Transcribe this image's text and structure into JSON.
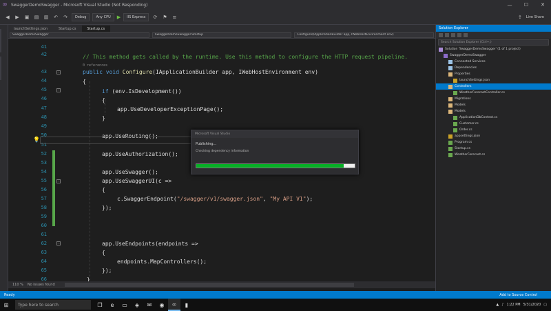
{
  "window": {
    "title": "SwaggerDemoSwagger - Microsoft Visual Studio (Not Responding)",
    "minimize": "—",
    "maximize": "☐",
    "close": "✕"
  },
  "toolbar": {
    "config": "Debug",
    "platform": "Any CPU",
    "run_target": "IIS Express",
    "live_share": "Live Share"
  },
  "doc_tabs": [
    "launchSettings.json",
    "Startup.cs",
    "Startup.cs"
  ],
  "nav": {
    "project": "SwaggerDemoSwagger",
    "class": "SwaggerDemoSwagger.Startup",
    "member": "Configure(IApplicationBuilder app, IWebHostEnvironment env)"
  },
  "editor": {
    "line_numbers": [
      "41",
      "42",
      "",
      "43",
      "44",
      "45",
      "46",
      "47",
      "48",
      "49",
      "50",
      "51",
      "52",
      "53",
      "54",
      "55",
      "56",
      "57",
      "58",
      "59",
      "60",
      "61",
      "62",
      "63",
      "64",
      "65",
      "66"
    ],
    "code": {
      "c1": "// This method gets called by the runtime. Use this method to configure the HTTP request pipeline.",
      "ref": "0 references",
      "c2_kw": "public void ",
      "c2_mt": "Configure",
      "c2_rest": "(IApplicationBuilder app, IWebHostEnvironment env)",
      "open1": "{",
      "if_kw": "if ",
      "if_rest": "(env.IsDevelopment())",
      "open2": "{",
      "dev": "app.UseDeveloperExceptionPage();",
      "close2": "}",
      "routing": "app.UseRouting();",
      "authz": "app.UseAuthorization();",
      "swag": "app.UseSwagger();",
      "swagui": "app.UseSwaggerUI(c =>",
      "open3": "{",
      "endpoint_pre": "c.SwaggerEndpoint(",
      "endpoint_s1": "\"/swagger/v1/swagger.json\"",
      "endpoint_mid": ", ",
      "endpoint_s2": "\"My API V1\"",
      "endpoint_post": ");",
      "close3": "});",
      "endpoints": "app.UseEndpoints(endpoints =>",
      "open4": "{",
      "map": "endpoints.MapControllers();",
      "close4": "});",
      "close1": "}"
    },
    "lightbulb": "💡"
  },
  "dialog": {
    "title": "Microsoft Visual Studio",
    "line1": "Publishing...",
    "line2": "Checking dependency information",
    "progress": 0.93
  },
  "footer": {
    "zoom": "110 %",
    "issues": "No issues found"
  },
  "solution_explorer": {
    "title": "Solution Explorer",
    "search": "Search Solution Explorer (Ctrl+;)",
    "items": [
      {
        "label": "Solution 'SwaggerDemoSwagger' (1 of 1 project)",
        "icon": "sol",
        "indent": 0,
        "selected": false
      },
      {
        "label": "SwaggerDemoSwagger",
        "icon": "proj",
        "indent": 1,
        "selected": false
      },
      {
        "label": "Connected Services",
        "icon": "dep",
        "indent": 2,
        "selected": false
      },
      {
        "label": "Dependencies",
        "icon": "dep",
        "indent": 2,
        "selected": false
      },
      {
        "label": "Properties",
        "icon": "folder",
        "indent": 2,
        "selected": false
      },
      {
        "label": "launchSettings.json",
        "icon": "json",
        "indent": 3,
        "selected": false
      },
      {
        "label": "Controllers",
        "icon": "folder",
        "indent": 2,
        "selected": true
      },
      {
        "label": "WeatherForecastController.cs",
        "icon": "cs",
        "indent": 3,
        "selected": false
      },
      {
        "label": "Migrations",
        "icon": "folder",
        "indent": 2,
        "selected": false
      },
      {
        "label": "Models",
        "icon": "folder",
        "indent": 2,
        "selected": false
      },
      {
        "label": "Models",
        "icon": "folder",
        "indent": 2,
        "selected": false
      },
      {
        "label": "ApplicationDbContext.cs",
        "icon": "cs",
        "indent": 3,
        "selected": false
      },
      {
        "label": "Customer.cs",
        "icon": "cs",
        "indent": 3,
        "selected": false
      },
      {
        "label": "Order.cs",
        "icon": "cs",
        "indent": 3,
        "selected": false
      },
      {
        "label": "appsettings.json",
        "icon": "json",
        "indent": 2,
        "selected": false
      },
      {
        "label": "Program.cs",
        "icon": "cs",
        "indent": 2,
        "selected": false
      },
      {
        "label": "Startup.cs",
        "icon": "cs",
        "indent": 2,
        "selected": false
      },
      {
        "label": "WeatherForecast.cs",
        "icon": "cs",
        "indent": 2,
        "selected": false
      }
    ]
  },
  "statusbar": {
    "left": "Ready",
    "right": "Add to Source Control"
  },
  "taskbar": {
    "search_placeholder": "Type here to search",
    "start_icon": "⊞",
    "time": "1:22 PM",
    "date": "5/31/2020"
  }
}
